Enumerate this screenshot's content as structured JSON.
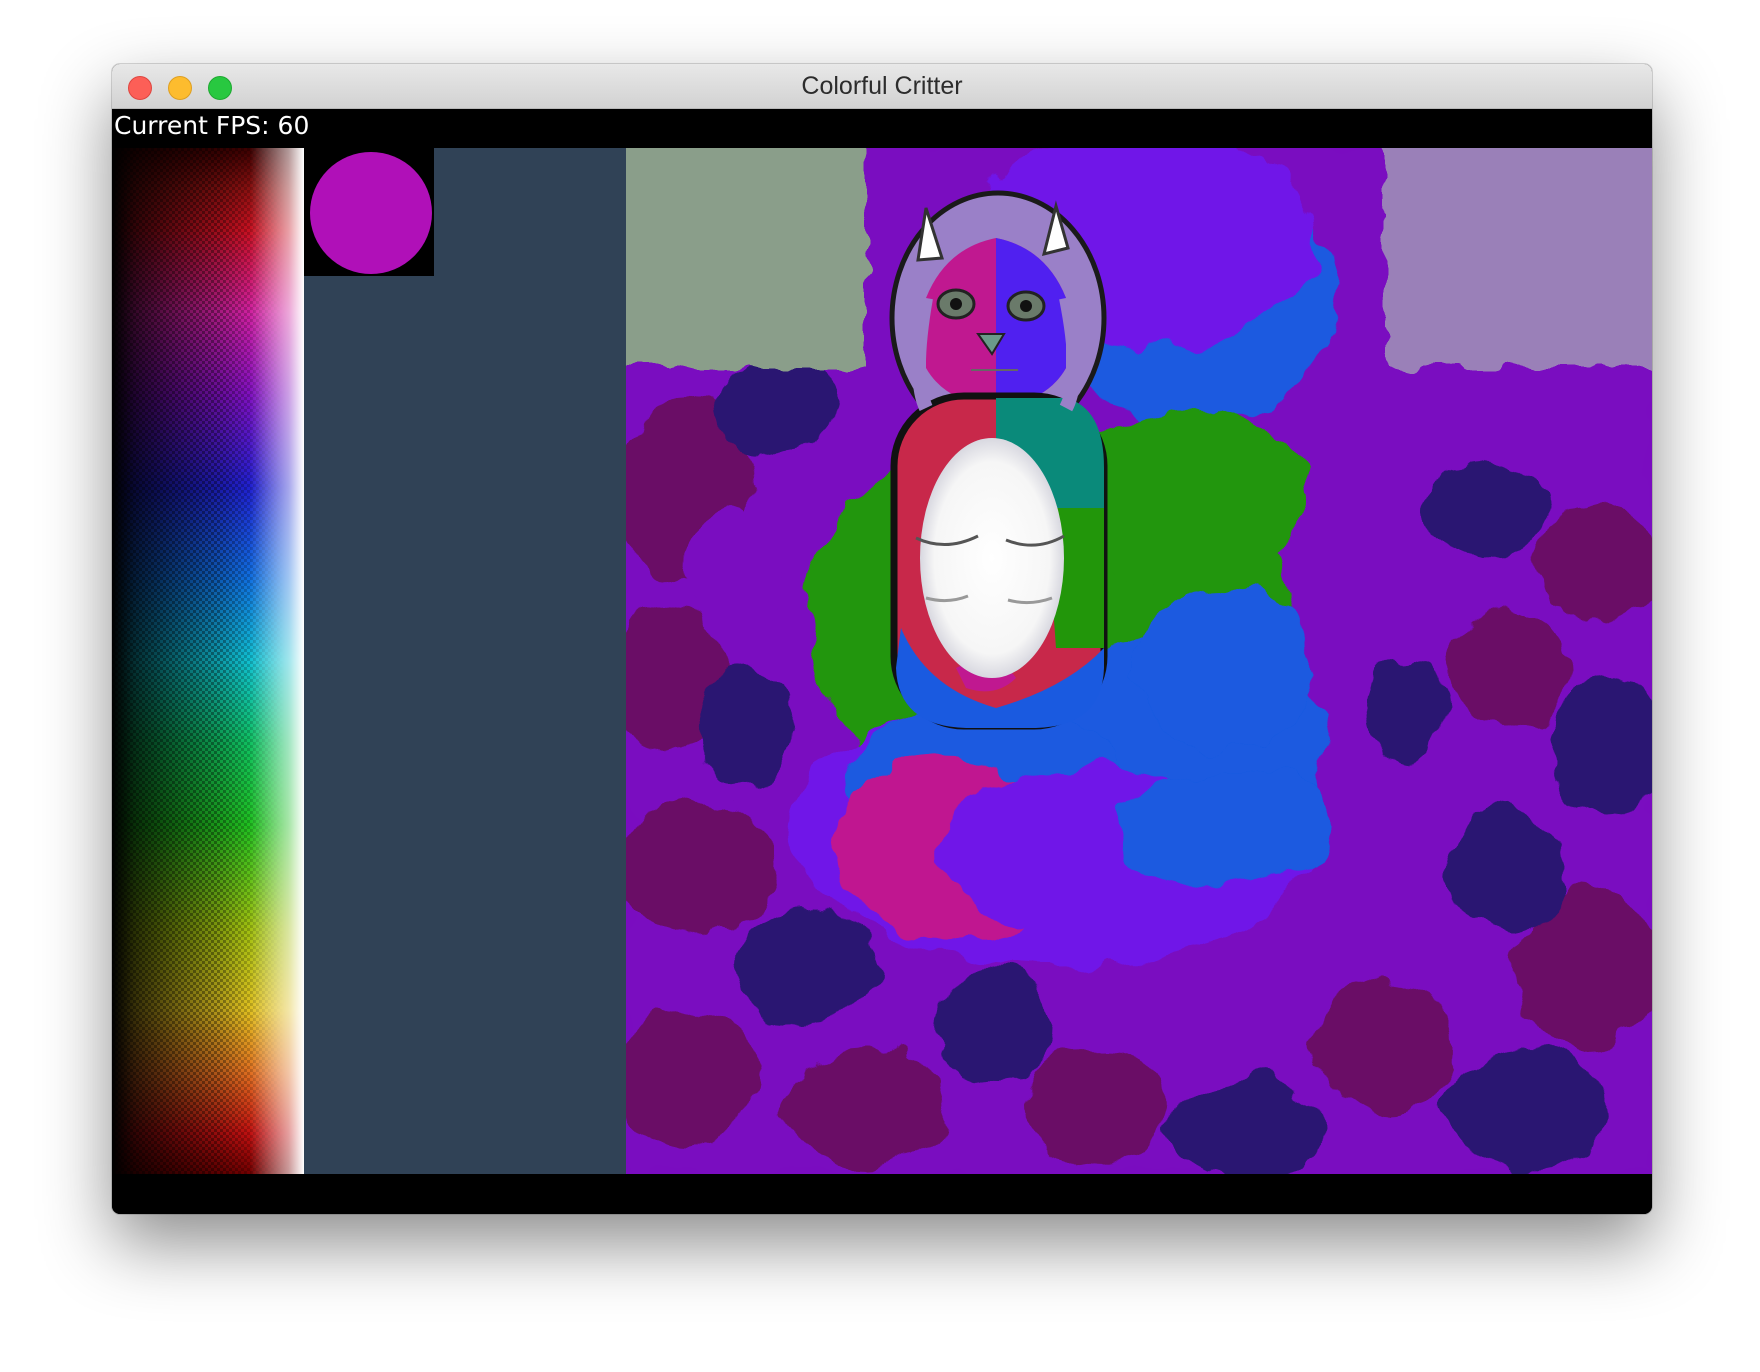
{
  "window": {
    "title": "Colorful Critter",
    "controls": [
      "close",
      "minimize",
      "zoom"
    ]
  },
  "hud": {
    "fps_text": "Current FPS: 60"
  },
  "tools": {
    "current_color": "#b010b8",
    "panel_color": "#304256"
  },
  "canvas": {
    "subject": "critter"
  }
}
